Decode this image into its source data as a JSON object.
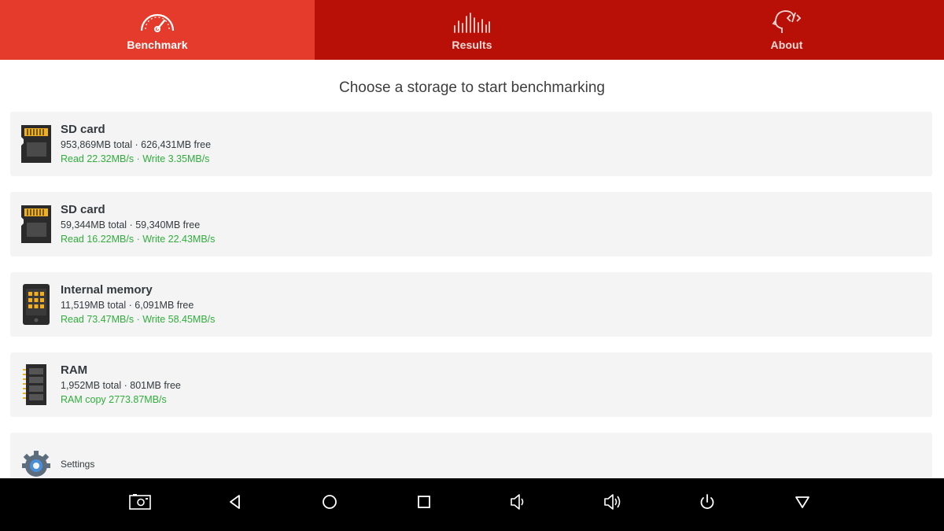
{
  "colors": {
    "tab_active": "#e53b2c",
    "tab_inactive": "#b81006",
    "card_bg": "#f4f4f4",
    "speed_green": "#2fae3c",
    "chip_gold": "#f2b01e",
    "navbar": "#000000"
  },
  "tabs": [
    {
      "label": "Benchmark",
      "icon": "speedometer-icon",
      "active": true
    },
    {
      "label": "Results",
      "icon": "bar-chart-icon",
      "active": false
    },
    {
      "label": "About",
      "icon": "head-code-icon",
      "active": false
    }
  ],
  "main": {
    "title": "Choose a storage to start benchmarking",
    "storages": [
      {
        "name": "SD card",
        "capacity": "953,869MB total · 626,431MB free",
        "speed": "Read 22.32MB/s · Write 3.35MB/s",
        "icon": "sd-card-icon"
      },
      {
        "name": "SD card",
        "capacity": "59,344MB total · 59,340MB free",
        "speed": "Read 16.22MB/s · Write 22.43MB/s",
        "icon": "sd-card-icon"
      },
      {
        "name": "Internal memory",
        "capacity": "11,519MB total · 6,091MB free",
        "speed": "Read 73.47MB/s · Write 58.45MB/s",
        "icon": "phone-chip-icon"
      },
      {
        "name": "RAM",
        "capacity": "1,952MB total · 801MB free",
        "speed": "RAM copy 2773.87MB/s",
        "icon": "ram-icon"
      }
    ],
    "settings": {
      "label": "Settings",
      "icon": "gear-icon"
    }
  },
  "navbar": {
    "buttons": [
      "screenshot-icon",
      "back-icon",
      "home-icon",
      "recents-icon",
      "volume-down-icon",
      "volume-up-icon",
      "power-icon",
      "hide-nav-icon"
    ]
  }
}
